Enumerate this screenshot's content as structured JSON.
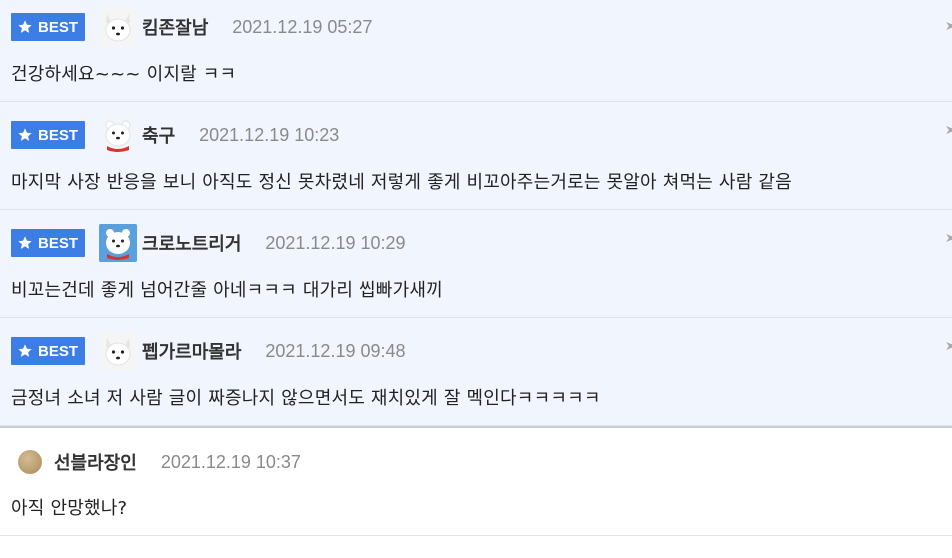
{
  "colors": {
    "best_badge": "#3d7ee6",
    "best_row_bg": "#f1f5fd",
    "timestamp": "#8a8a8a"
  },
  "comments": [
    {
      "badge": "BEST",
      "badge_icon": "star-icon",
      "avatar": "white-dog-avatar",
      "nickname": "킴존잘남",
      "timestamp": "2021.12.19 05:27",
      "text": "건강하세요~~~ 이지랄 ㅋㅋ"
    },
    {
      "badge": "BEST",
      "badge_icon": "star-icon",
      "avatar": "polar-bear-avatar",
      "nickname": "축구",
      "timestamp": "2021.12.19 10:23",
      "text": "마지막 사장 반응을 보니 아직도 정신 못차렸네 저렇게 좋게 비꼬아주는거로는 못알아 쳐먹는 사람 같음"
    },
    {
      "badge": "BEST",
      "badge_icon": "star-icon",
      "avatar": "polar-bear-avatar",
      "nickname": "크로노트리거",
      "timestamp": "2021.12.19 10:29",
      "text": "비꼬는건데 좋게 넘어간줄 아네ㅋㅋㅋ 대가리 씹빠가새끼"
    },
    {
      "badge": "BEST",
      "badge_icon": "star-icon",
      "avatar": "white-dog-avatar",
      "nickname": "펩가르마몰라",
      "timestamp": "2021.12.19 09:48",
      "text": "금정녀 소녀 저 사람 글이 짜증나지 않으면서도 재치있게 잘 멕인다ㅋㅋㅋㅋㅋ"
    },
    {
      "avatar": "default-avatar",
      "nickname": "선블라장인",
      "timestamp": "2021.12.19 10:37",
      "text": "아직 안망했나?"
    }
  ]
}
